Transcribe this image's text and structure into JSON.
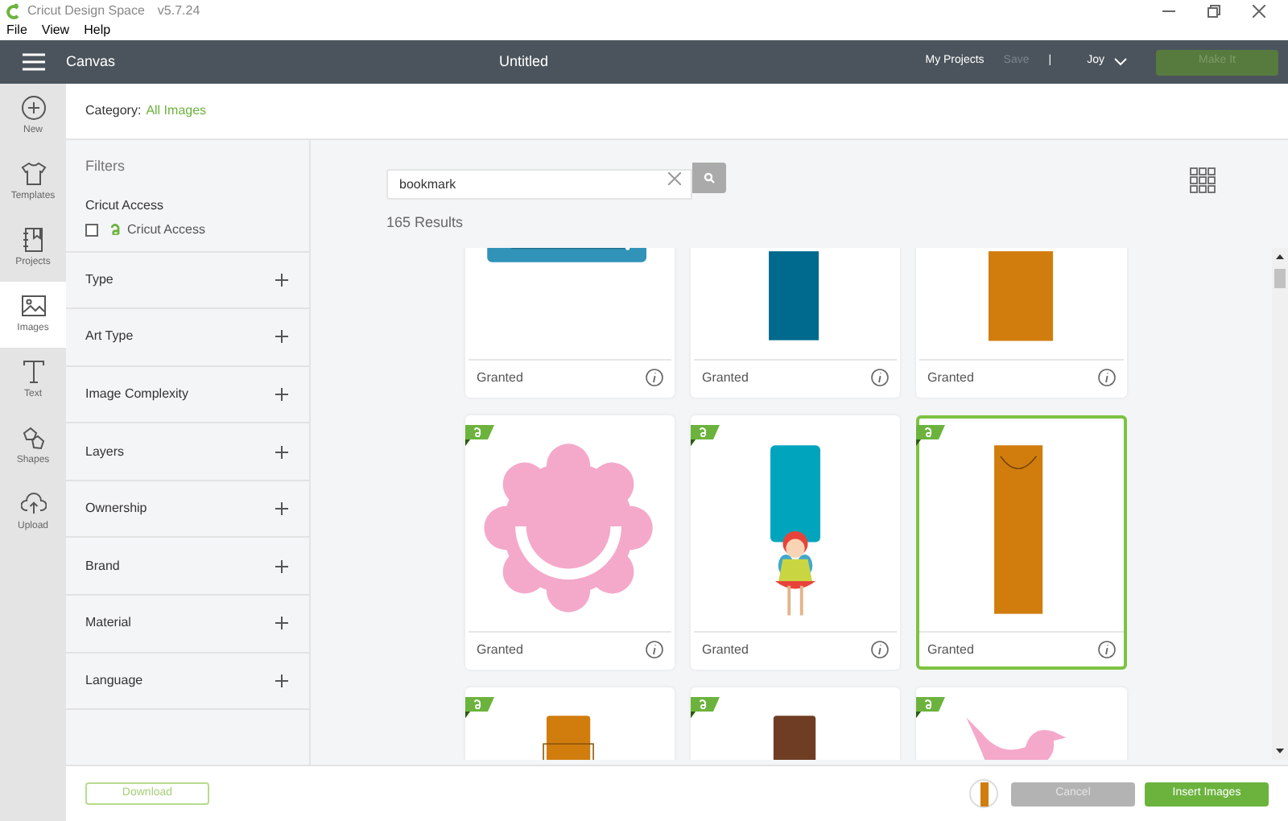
{
  "window": {
    "title": "Cricut Design Space",
    "version": "v5.7.24"
  },
  "menu": [
    "File",
    "View",
    "Help"
  ],
  "header": {
    "section": "Canvas",
    "document": "Untitled",
    "links": [
      {
        "label": "My Projects",
        "disabled": false
      },
      {
        "label": "Save",
        "disabled": true
      }
    ],
    "separator": "|",
    "user": "Joy",
    "action": {
      "label": "Make It",
      "disabled": true
    }
  },
  "rail": [
    {
      "label": "New",
      "kind": "plus",
      "selected": false
    },
    {
      "label": "Templates",
      "kind": "shirt",
      "selected": false
    },
    {
      "label": "Projects",
      "kind": "notebook",
      "selected": false
    },
    {
      "label": "Images",
      "kind": "image",
      "selected": true
    },
    {
      "label": "Text",
      "kind": "text",
      "selected": false
    },
    {
      "label": "Shapes",
      "kind": "shapes",
      "selected": false
    },
    {
      "label": "Upload",
      "kind": "upload",
      "selected": false
    }
  ],
  "category": {
    "label": "Category:",
    "value": "All Images"
  },
  "filters": {
    "title": "Filters",
    "access": {
      "heading": "Cricut Access",
      "option": "Cricut Access",
      "checked": false
    },
    "sections": [
      {
        "label": "Type",
        "expanded": false
      },
      {
        "label": "Art Type",
        "expanded": false
      },
      {
        "label": "Image Complexity",
        "expanded": false
      },
      {
        "label": "Layers",
        "expanded": false
      },
      {
        "label": "Ownership",
        "expanded": false
      },
      {
        "label": "Brand",
        "expanded": false
      },
      {
        "label": "Material",
        "expanded": false
      },
      {
        "label": "Language",
        "expanded": false
      }
    ]
  },
  "search": {
    "value": "bookmark"
  },
  "results": "165 Results",
  "cards": [
    {
      "kind": "tealcard",
      "selected": false,
      "label": "Granted"
    },
    {
      "kind": "bluebar",
      "selected": false,
      "label": "Granted"
    },
    {
      "kind": "orangebar",
      "selected": false,
      "label": "Granted"
    },
    {
      "kind": "flower",
      "access": true,
      "selected": false,
      "label": "Granted"
    },
    {
      "kind": "figure",
      "access": true,
      "selected": false,
      "label": "Granted"
    },
    {
      "kind": "bag",
      "access": true,
      "selected": true,
      "label": "Granted"
    },
    {
      "kind": "orangetab",
      "access": true,
      "selected": false
    },
    {
      "kind": "browntab",
      "access": true,
      "selected": false
    },
    {
      "kind": "bird",
      "access": true,
      "selected": false
    }
  ],
  "footer": {
    "download": "Download",
    "cancel": "Cancel",
    "insert": "Insert Images"
  }
}
